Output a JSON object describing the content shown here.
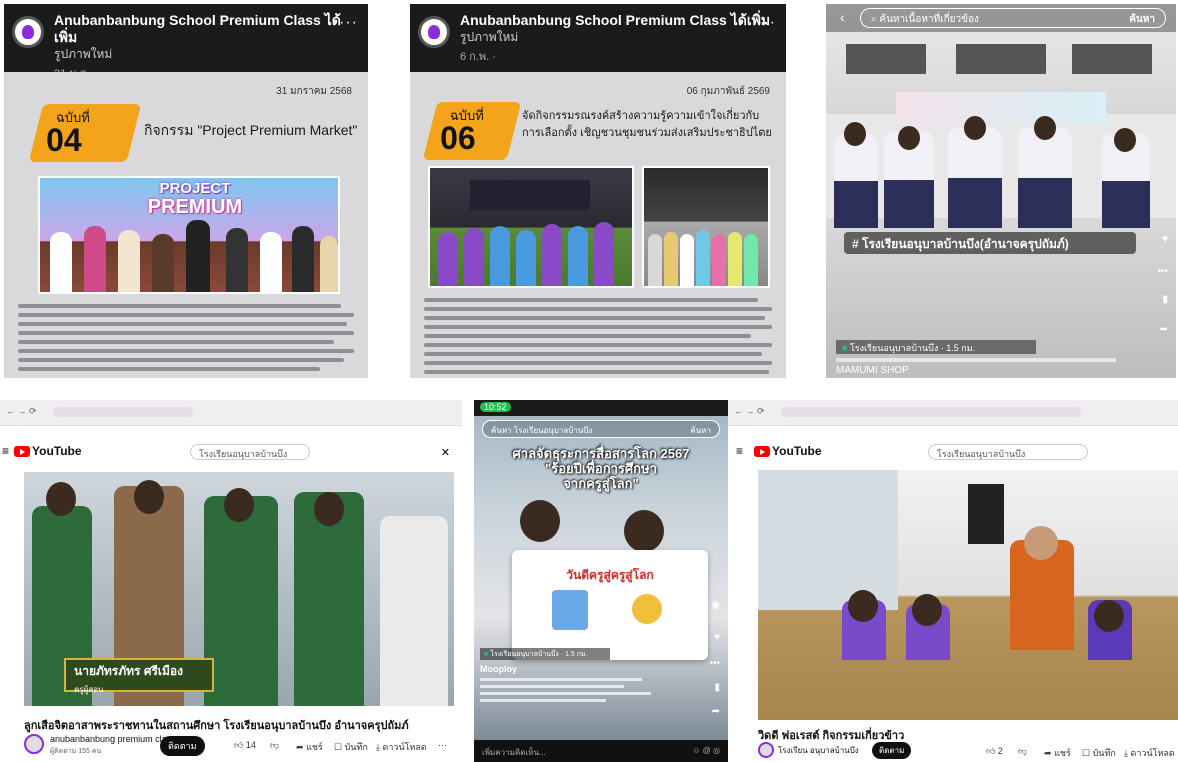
{
  "panel1": {
    "page": "Anubanbanbung School Premium Class",
    "action_line1": "ได้เพิ่ม",
    "action_line2": "รูปภาพใหม่",
    "time": "31 ม.ค. · ",
    "more": "···",
    "date": "31 มกราคม 2568",
    "issue_label": "ฉบับที่",
    "issue_number": "04",
    "headline": "กิจกรรม \"Project Premium Market\"",
    "banner_line1": "PROJECT",
    "banner_line2": "PREMIUM"
  },
  "panel2": {
    "page": "Anubanbanbung School Premium Class",
    "action_line1": "ได้เพิ่ม",
    "action_line2": "รูปภาพใหม่",
    "time": "6 ก.พ. · ",
    "more": "···",
    "date": "06 กุมภาพันธ์ 2569",
    "issue_label": "ฉบับที่",
    "issue_number": "06",
    "headline": "จัดกิจกรรมรณรงค์สร้างความรู้ความเข้าใจเกี่ยวกับการเลือกตั้ง เชิญชวนชุมชนร่วมส่งเสริมประชาธิปไตย"
  },
  "panel3": {
    "search_placeholder": "ค้นหาเนื้อหาที่เกี่ยวข้อง",
    "search_button": "ค้นหา",
    "hashtag": "# โรงเรียนอนุบาลบ้านบึง(อำนาจครุปถัมภ์)",
    "location_line1": "โรงเรียนอนุบาลบ้านบึง · 1.5 กม.",
    "shop": "MAMUMI SHOP"
  },
  "panel4": {
    "search": "โรงเรียนอนุบาลบ้านบึง",
    "logo": "YouTube",
    "caption_name": "นายภัทรภัทร ศรีเมือง",
    "caption_role": "ครูผู้สอน",
    "title": "ลูกเสือจิตอาสาพระราชทานในสถานศึกษา โรงเรียนอนุบาลบ้านบึง อำนาจครุปถัมภ์",
    "channel": "anubanbanbung premium class",
    "channel_subs": "ผู้ติดตาม 155 คน",
    "subscribe": "ติดตาม",
    "likes": "14",
    "share": "แชร์",
    "save": "บันทึก",
    "download": "ดาวน์โหลด"
  },
  "panel5": {
    "time": "10:52",
    "search": "ค้นหา โรงเรียนอนุบาลบ้านบึง",
    "search_btn": "ค้นหา",
    "overlay_line1": "ศาลจัดธุระการสื่อสารโลก 2567",
    "overlay_line2": "\"ร้อยปีเพื่อการศึกษา",
    "overlay_line3": "จากครูสู่โลก\"",
    "card_title": "วันดีครูสู่ครูสู่โลก",
    "location": "โรงเรียนอนุบาลบ้านบึง · 1.5 กม.",
    "user": "Mooploy",
    "comment_placeholder": "เพิ่มความคิดเห็น..."
  },
  "panel6": {
    "search": "โรงเรียนอนุบาลบ้านบึง",
    "logo": "YouTube",
    "title": "วิดดี ฟอเรสต์ กิจกรรมเกี่ยวข้าว",
    "channel": "โรงเรียน อนุบาลบ้านบึง",
    "subscribe": "ติดตาม",
    "likes": "2",
    "share": "แชร์",
    "save": "บันทึก",
    "download": "ดาวน์โหลด"
  }
}
